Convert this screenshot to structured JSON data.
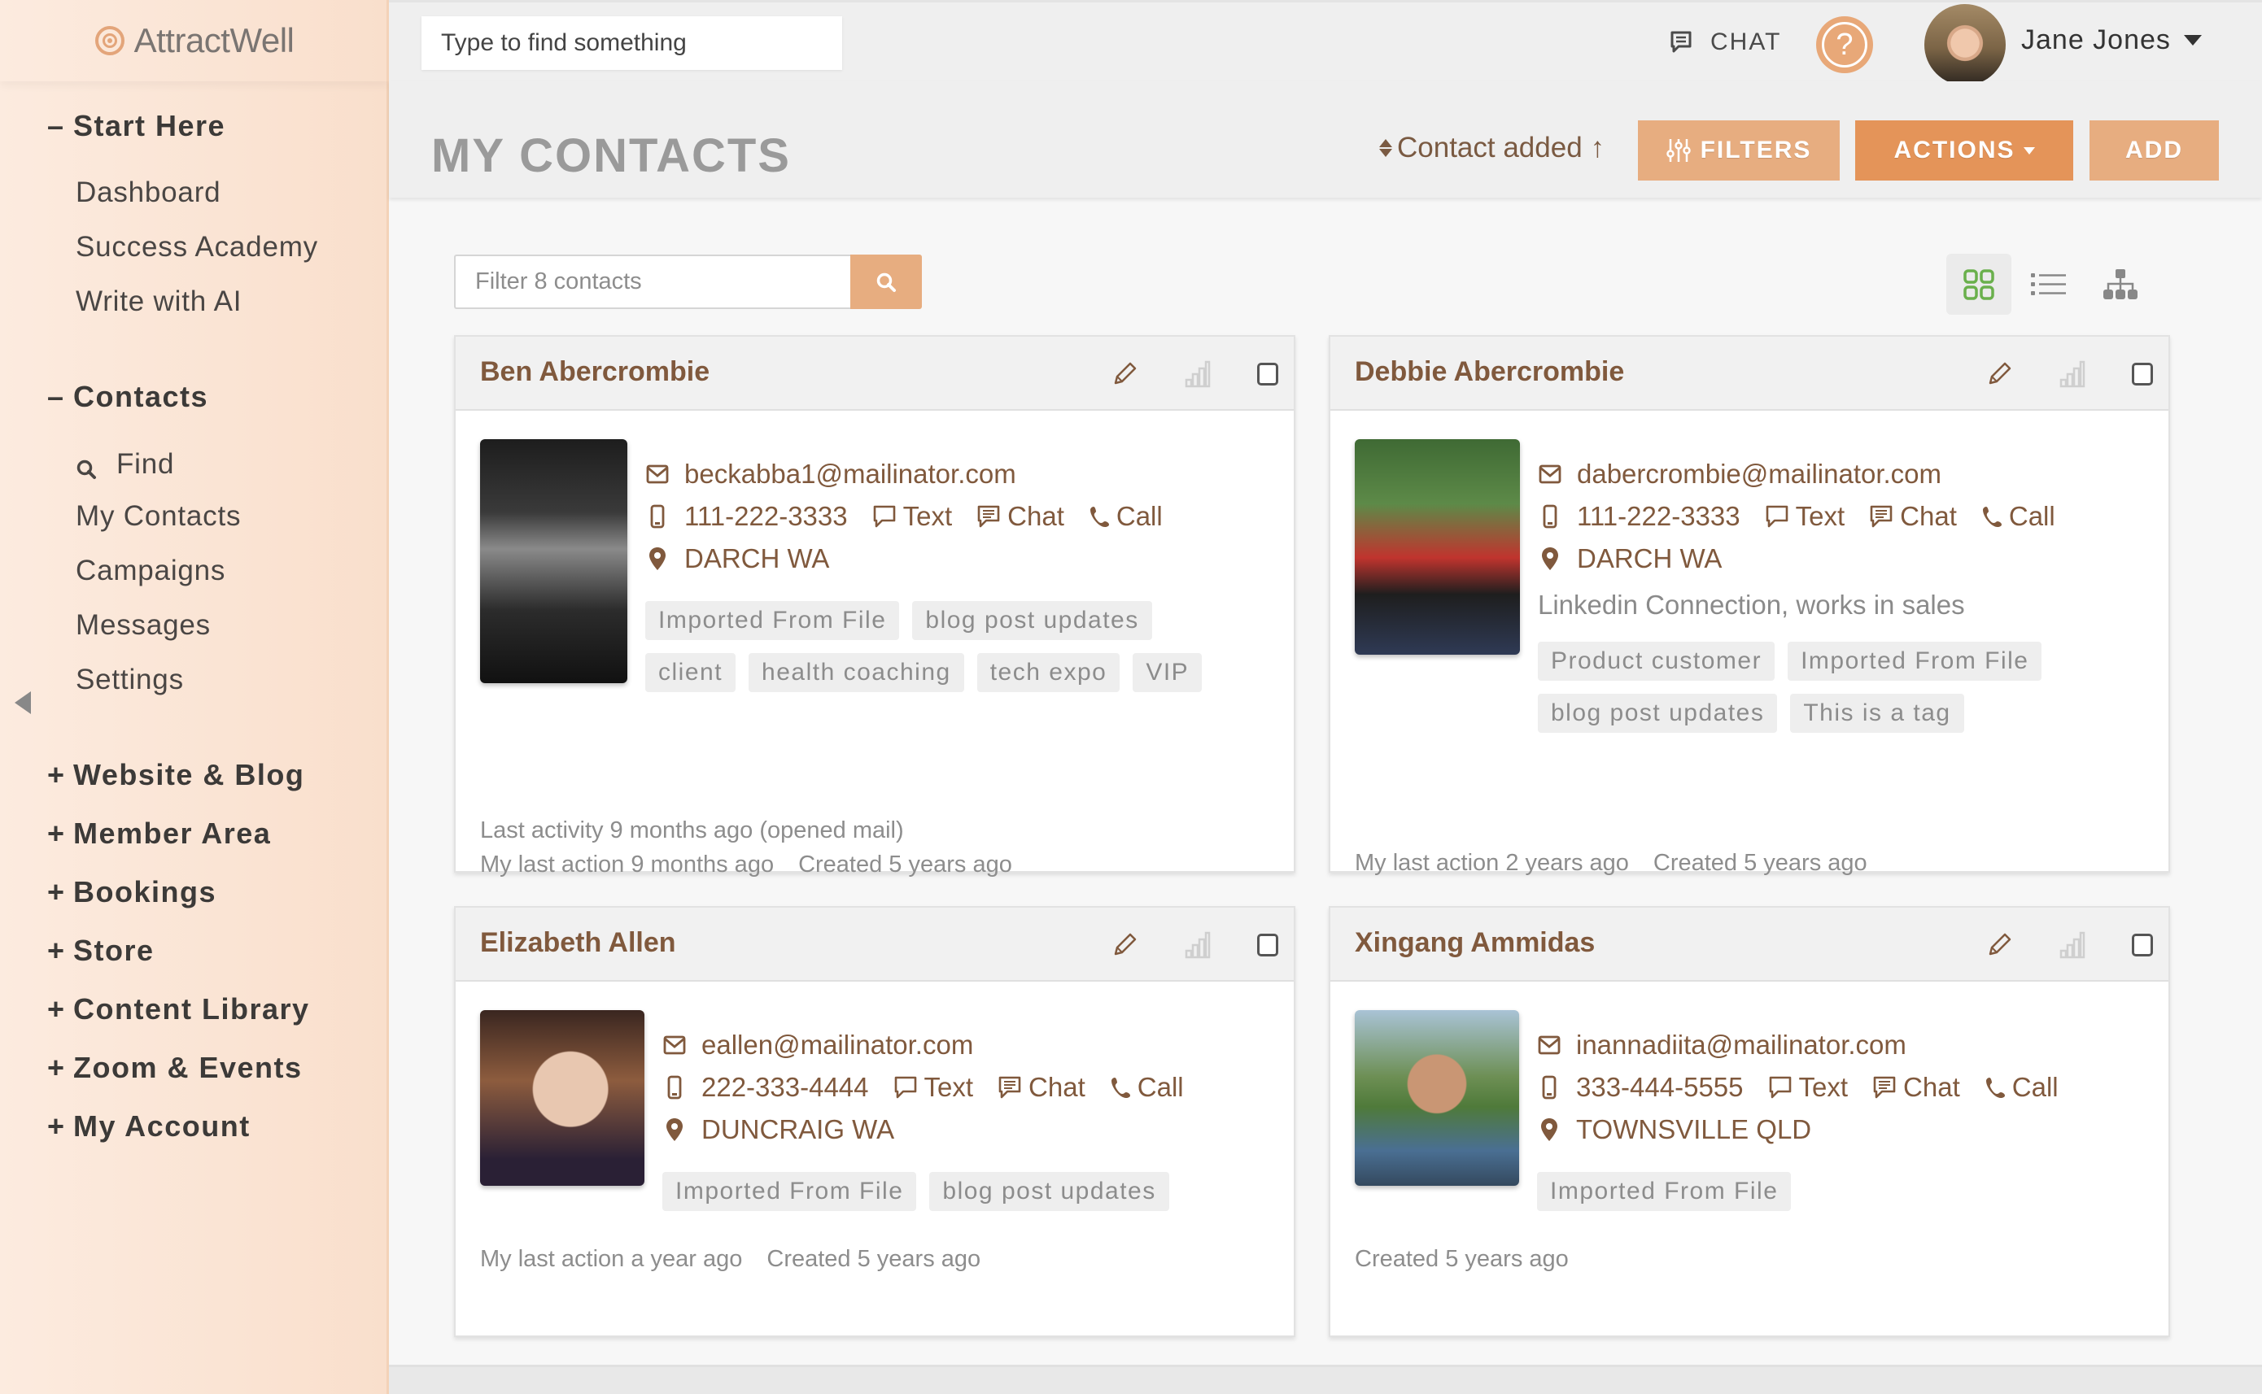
{
  "app": {
    "name": "AttractWell",
    "brand_color": "#e3a57a",
    "accent_color": "#e49459",
    "name_color": "#80593d"
  },
  "sidebar": {
    "sections": [
      {
        "sign": "–",
        "label": "Start Here",
        "items": [
          {
            "label": "Dashboard"
          },
          {
            "label": "Success Academy"
          },
          {
            "label": "Write with AI"
          }
        ]
      },
      {
        "sign": "–",
        "label": "Contacts",
        "items": [
          {
            "label": "Find",
            "icon": "search-icon"
          },
          {
            "label": "My Contacts"
          },
          {
            "label": "Campaigns"
          },
          {
            "label": "Messages"
          },
          {
            "label": "Settings"
          }
        ]
      },
      {
        "sign": "+",
        "label": "Website & Blog"
      },
      {
        "sign": "+",
        "label": "Member Area"
      },
      {
        "sign": "+",
        "label": "Bookings"
      },
      {
        "sign": "+",
        "label": "Store"
      },
      {
        "sign": "+",
        "label": "Content Library"
      },
      {
        "sign": "+",
        "label": "Zoom & Events"
      },
      {
        "sign": "+",
        "label": "My Account"
      }
    ]
  },
  "topbar": {
    "search_placeholder": "Type to find something",
    "chat_label": "CHAT",
    "help_label": "?",
    "user_name": "Jane Jones"
  },
  "header": {
    "title": "MY CONTACTS",
    "sort_label": "Contact added",
    "sort_direction": "↑",
    "filters_label": "FILTERS",
    "actions_label": "ACTIONS",
    "add_label": "ADD"
  },
  "filter": {
    "placeholder": "Filter 8 contacts"
  },
  "views": {
    "active": "grid",
    "options": [
      "grid",
      "list",
      "tree"
    ],
    "active_color": "#6ab04c"
  },
  "actions": {
    "text": "Text",
    "chat": "Chat",
    "call": "Call"
  },
  "contacts": [
    {
      "name": "Ben Abercrombie",
      "email": "beckabba1@mailinator.com",
      "phone": "111-222-3333",
      "location": "DARCH WA",
      "note": "",
      "tags": [
        "Imported From File",
        "blog post updates",
        "client",
        "health coaching",
        "tech expo",
        "VIP"
      ],
      "meta": [
        "Last activity 9 months ago (opened mail)"
      ],
      "meta2": [
        "My last action 9 months ago",
        "Created 5 years ago"
      ]
    },
    {
      "name": "Debbie Abercrombie",
      "email": "dabercrombie@mailinator.com",
      "phone": "111-222-3333",
      "location": "DARCH WA",
      "note": "Linkedin Connection, works in sales",
      "tags": [
        "Product customer",
        "Imported From File",
        "blog post updates",
        "This is a tag"
      ],
      "meta": [],
      "meta2": [
        "My last action 2 years ago",
        "Created 5 years ago"
      ]
    },
    {
      "name": "Elizabeth Allen",
      "email": "eallen@mailinator.com",
      "phone": "222-333-4444",
      "location": "DUNCRAIG WA",
      "note": "",
      "tags": [
        "Imported From File",
        "blog post updates"
      ],
      "meta": [],
      "meta2": [
        "My last action a year ago",
        "Created 5 years ago"
      ]
    },
    {
      "name": "Xingang Ammidas",
      "email": "inannadiita@mailinator.com",
      "phone": "333-444-5555",
      "location": "TOWNSVILLE QLD",
      "note": "",
      "tags": [
        "Imported From File"
      ],
      "meta": [],
      "meta2": [
        "Created 5 years ago"
      ]
    }
  ]
}
